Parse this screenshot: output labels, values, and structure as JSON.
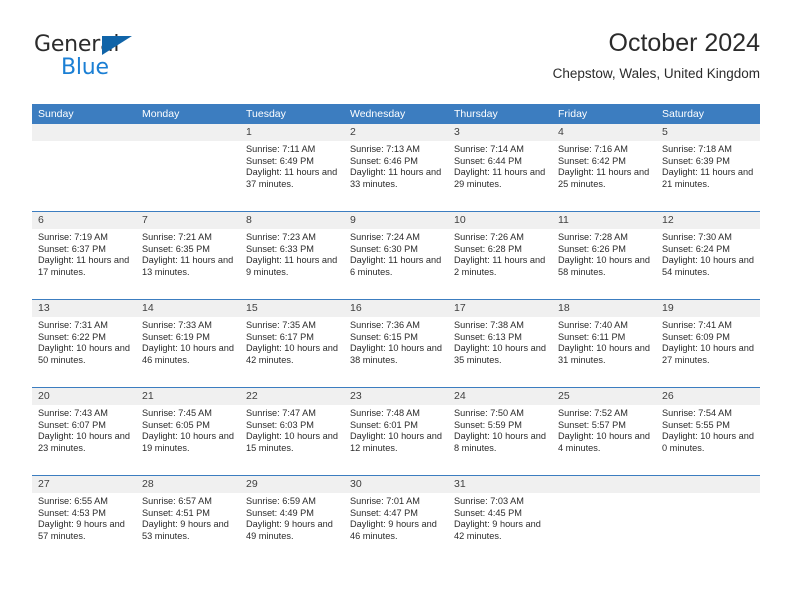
{
  "logo": {
    "word_top": "General",
    "word_bottom": "Blue",
    "triangle_color": "#1064a8",
    "blue_color": "#1b7fd4"
  },
  "header": {
    "title": "October 2024",
    "subtitle": "Chepstow, Wales, United Kingdom"
  },
  "theme": {
    "header_blue": "#3c7dc0",
    "day_band_gray": "#f0f0f0",
    "text_color": "#2b2b2b"
  },
  "calendar": {
    "weekday_headers": [
      "Sunday",
      "Monday",
      "Tuesday",
      "Wednesday",
      "Thursday",
      "Friday",
      "Saturday"
    ],
    "labels": {
      "sunrise": "Sunrise:",
      "sunset": "Sunset:",
      "daylight": "Daylight:"
    },
    "weeks": [
      [
        {
          "day": "",
          "sunrise": "",
          "sunset": "",
          "daylight": ""
        },
        {
          "day": "",
          "sunrise": "",
          "sunset": "",
          "daylight": ""
        },
        {
          "day": "1",
          "sunrise": "Sunrise: 7:11 AM",
          "sunset": "Sunset: 6:49 PM",
          "daylight": "Daylight: 11 hours and 37 minutes."
        },
        {
          "day": "2",
          "sunrise": "Sunrise: 7:13 AM",
          "sunset": "Sunset: 6:46 PM",
          "daylight": "Daylight: 11 hours and 33 minutes."
        },
        {
          "day": "3",
          "sunrise": "Sunrise: 7:14 AM",
          "sunset": "Sunset: 6:44 PM",
          "daylight": "Daylight: 11 hours and 29 minutes."
        },
        {
          "day": "4",
          "sunrise": "Sunrise: 7:16 AM",
          "sunset": "Sunset: 6:42 PM",
          "daylight": "Daylight: 11 hours and 25 minutes."
        },
        {
          "day": "5",
          "sunrise": "Sunrise: 7:18 AM",
          "sunset": "Sunset: 6:39 PM",
          "daylight": "Daylight: 11 hours and 21 minutes."
        }
      ],
      [
        {
          "day": "6",
          "sunrise": "Sunrise: 7:19 AM",
          "sunset": "Sunset: 6:37 PM",
          "daylight": "Daylight: 11 hours and 17 minutes."
        },
        {
          "day": "7",
          "sunrise": "Sunrise: 7:21 AM",
          "sunset": "Sunset: 6:35 PM",
          "daylight": "Daylight: 11 hours and 13 minutes."
        },
        {
          "day": "8",
          "sunrise": "Sunrise: 7:23 AM",
          "sunset": "Sunset: 6:33 PM",
          "daylight": "Daylight: 11 hours and 9 minutes."
        },
        {
          "day": "9",
          "sunrise": "Sunrise: 7:24 AM",
          "sunset": "Sunset: 6:30 PM",
          "daylight": "Daylight: 11 hours and 6 minutes."
        },
        {
          "day": "10",
          "sunrise": "Sunrise: 7:26 AM",
          "sunset": "Sunset: 6:28 PM",
          "daylight": "Daylight: 11 hours and 2 minutes."
        },
        {
          "day": "11",
          "sunrise": "Sunrise: 7:28 AM",
          "sunset": "Sunset: 6:26 PM",
          "daylight": "Daylight: 10 hours and 58 minutes."
        },
        {
          "day": "12",
          "sunrise": "Sunrise: 7:30 AM",
          "sunset": "Sunset: 6:24 PM",
          "daylight": "Daylight: 10 hours and 54 minutes."
        }
      ],
      [
        {
          "day": "13",
          "sunrise": "Sunrise: 7:31 AM",
          "sunset": "Sunset: 6:22 PM",
          "daylight": "Daylight: 10 hours and 50 minutes."
        },
        {
          "day": "14",
          "sunrise": "Sunrise: 7:33 AM",
          "sunset": "Sunset: 6:19 PM",
          "daylight": "Daylight: 10 hours and 46 minutes."
        },
        {
          "day": "15",
          "sunrise": "Sunrise: 7:35 AM",
          "sunset": "Sunset: 6:17 PM",
          "daylight": "Daylight: 10 hours and 42 minutes."
        },
        {
          "day": "16",
          "sunrise": "Sunrise: 7:36 AM",
          "sunset": "Sunset: 6:15 PM",
          "daylight": "Daylight: 10 hours and 38 minutes."
        },
        {
          "day": "17",
          "sunrise": "Sunrise: 7:38 AM",
          "sunset": "Sunset: 6:13 PM",
          "daylight": "Daylight: 10 hours and 35 minutes."
        },
        {
          "day": "18",
          "sunrise": "Sunrise: 7:40 AM",
          "sunset": "Sunset: 6:11 PM",
          "daylight": "Daylight: 10 hours and 31 minutes."
        },
        {
          "day": "19",
          "sunrise": "Sunrise: 7:41 AM",
          "sunset": "Sunset: 6:09 PM",
          "daylight": "Daylight: 10 hours and 27 minutes."
        }
      ],
      [
        {
          "day": "20",
          "sunrise": "Sunrise: 7:43 AM",
          "sunset": "Sunset: 6:07 PM",
          "daylight": "Daylight: 10 hours and 23 minutes."
        },
        {
          "day": "21",
          "sunrise": "Sunrise: 7:45 AM",
          "sunset": "Sunset: 6:05 PM",
          "daylight": "Daylight: 10 hours and 19 minutes."
        },
        {
          "day": "22",
          "sunrise": "Sunrise: 7:47 AM",
          "sunset": "Sunset: 6:03 PM",
          "daylight": "Daylight: 10 hours and 15 minutes."
        },
        {
          "day": "23",
          "sunrise": "Sunrise: 7:48 AM",
          "sunset": "Sunset: 6:01 PM",
          "daylight": "Daylight: 10 hours and 12 minutes."
        },
        {
          "day": "24",
          "sunrise": "Sunrise: 7:50 AM",
          "sunset": "Sunset: 5:59 PM",
          "daylight": "Daylight: 10 hours and 8 minutes."
        },
        {
          "day": "25",
          "sunrise": "Sunrise: 7:52 AM",
          "sunset": "Sunset: 5:57 PM",
          "daylight": "Daylight: 10 hours and 4 minutes."
        },
        {
          "day": "26",
          "sunrise": "Sunrise: 7:54 AM",
          "sunset": "Sunset: 5:55 PM",
          "daylight": "Daylight: 10 hours and 0 minutes."
        }
      ],
      [
        {
          "day": "27",
          "sunrise": "Sunrise: 6:55 AM",
          "sunset": "Sunset: 4:53 PM",
          "daylight": "Daylight: 9 hours and 57 minutes."
        },
        {
          "day": "28",
          "sunrise": "Sunrise: 6:57 AM",
          "sunset": "Sunset: 4:51 PM",
          "daylight": "Daylight: 9 hours and 53 minutes."
        },
        {
          "day": "29",
          "sunrise": "Sunrise: 6:59 AM",
          "sunset": "Sunset: 4:49 PM",
          "daylight": "Daylight: 9 hours and 49 minutes."
        },
        {
          "day": "30",
          "sunrise": "Sunrise: 7:01 AM",
          "sunset": "Sunset: 4:47 PM",
          "daylight": "Daylight: 9 hours and 46 minutes."
        },
        {
          "day": "31",
          "sunrise": "Sunrise: 7:03 AM",
          "sunset": "Sunset: 4:45 PM",
          "daylight": "Daylight: 9 hours and 42 minutes."
        },
        {
          "day": "",
          "sunrise": "",
          "sunset": "",
          "daylight": ""
        },
        {
          "day": "",
          "sunrise": "",
          "sunset": "",
          "daylight": ""
        }
      ]
    ]
  }
}
